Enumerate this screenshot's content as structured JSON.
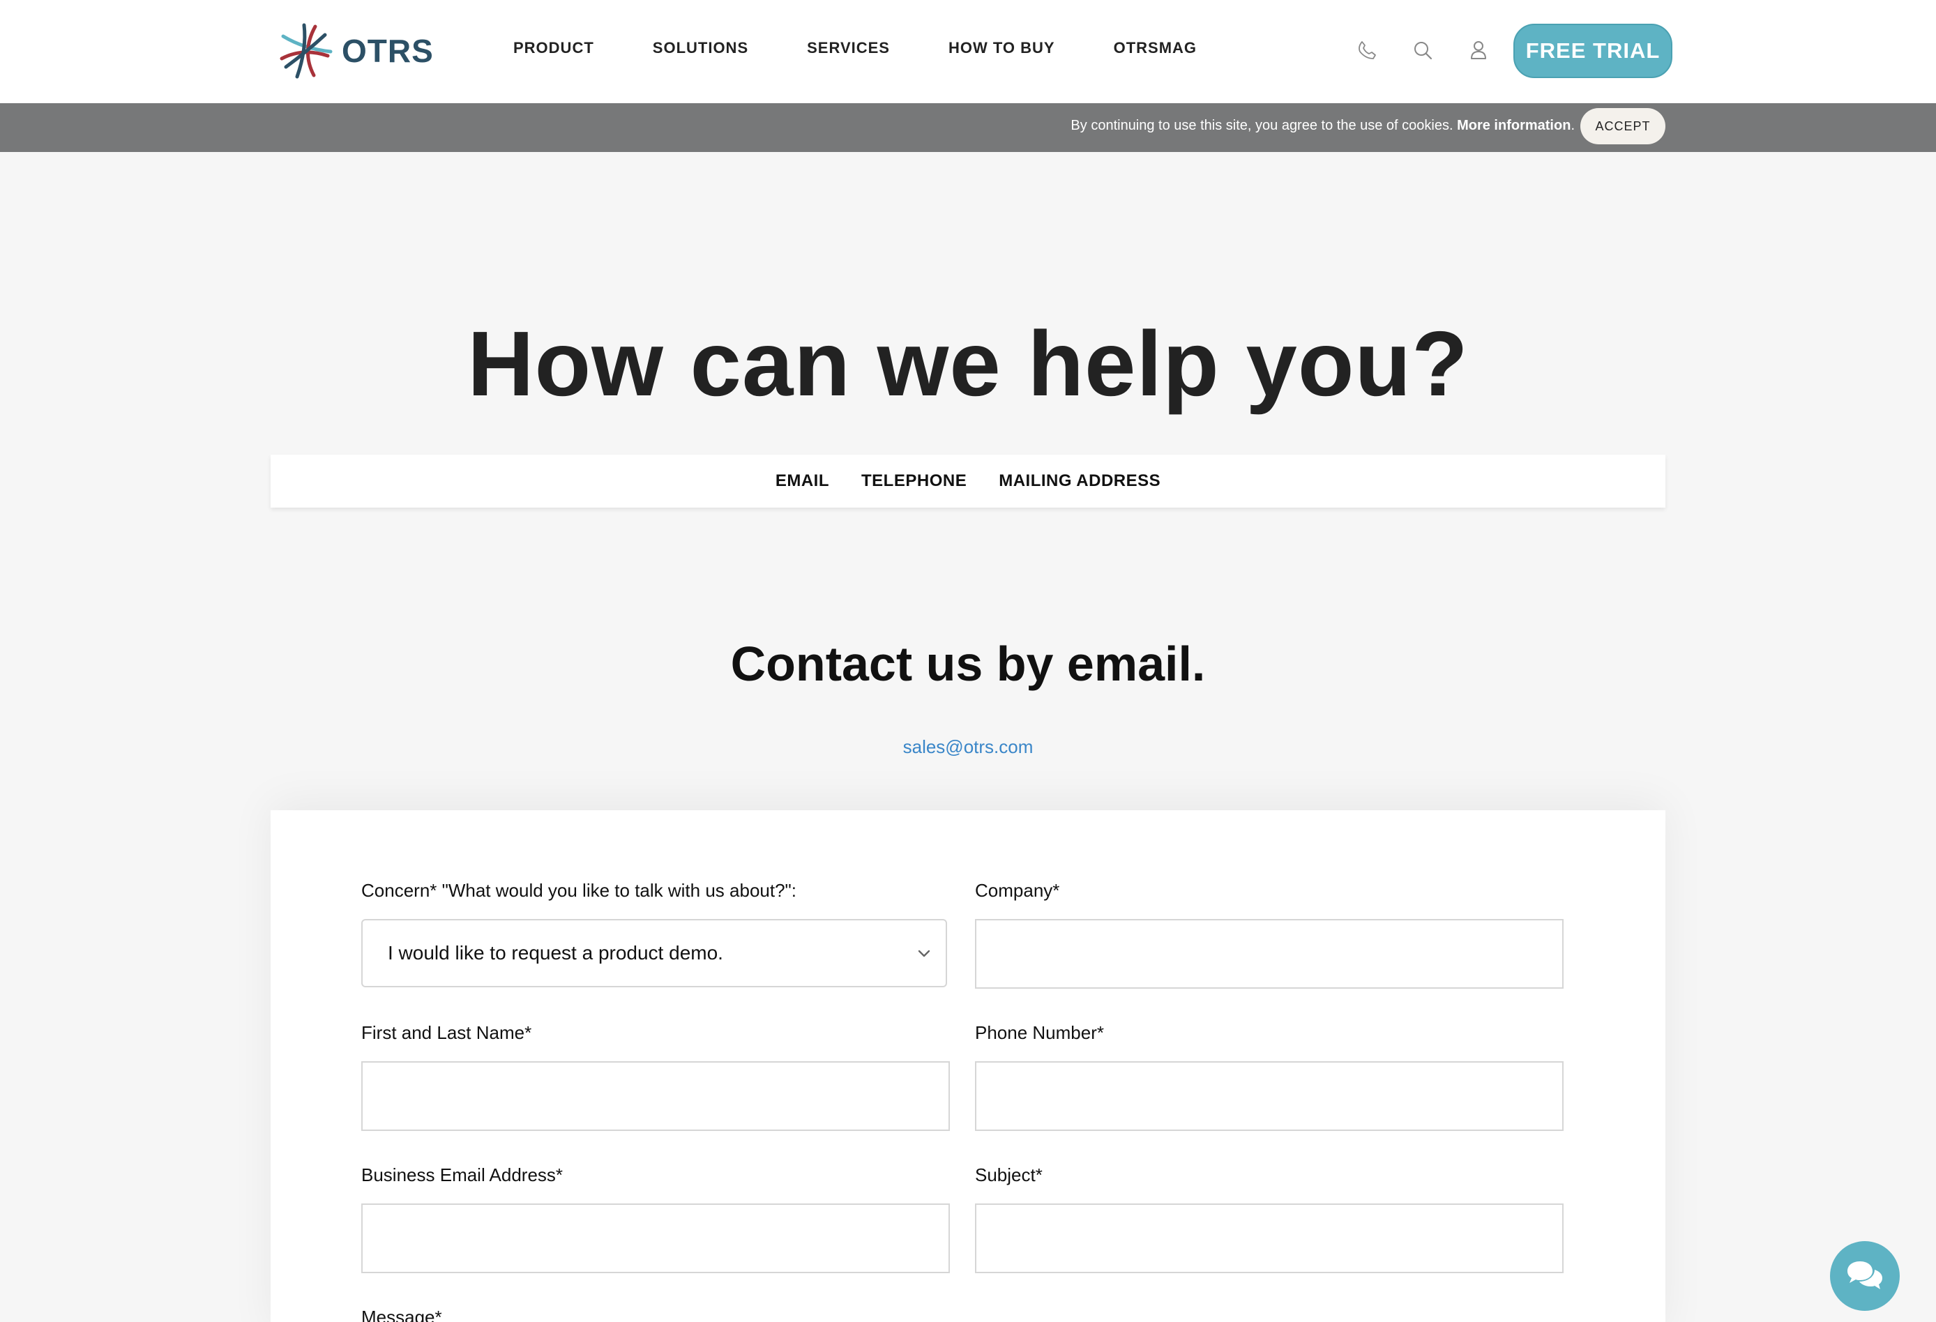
{
  "brand": {
    "name": "OTRS",
    "colors": {
      "primary": "#5eb3c4",
      "dark": "#2c5066",
      "logo_red": "#a8323a",
      "link": "#3a86c8"
    }
  },
  "nav": {
    "items": [
      {
        "label": "PRODUCT"
      },
      {
        "label": "SOLUTIONS"
      },
      {
        "label": "SERVICES"
      },
      {
        "label": "HOW TO BUY"
      },
      {
        "label": "OTRSMAG"
      }
    ],
    "icons": [
      "phone-icon",
      "search-icon",
      "user-icon"
    ],
    "cta_label": "FREE TRIAL"
  },
  "cookie_bar": {
    "text": "By continuing to use this site, you agree to the use of cookies.",
    "more_label": "More information",
    "after_more": ".",
    "accept_label": "ACCEPT"
  },
  "hero": {
    "title": "How can we help you?",
    "tabs": [
      {
        "label": "EMAIL"
      },
      {
        "label": "TELEPHONE"
      },
      {
        "label": "MAILING ADDRESS"
      }
    ]
  },
  "contact": {
    "title": "Contact us by email.",
    "email": "sales@otrs.com"
  },
  "form": {
    "concern_label": "Concern* \"What would you like to talk with us about?\":",
    "concern_value": "I would like to request a product demo.",
    "company_label": "Company*",
    "company_value": "",
    "name_label": "First and Last Name*",
    "name_value": "",
    "phone_label": "Phone Number*",
    "phone_value": "",
    "business_email_label": "Business Email Address*",
    "business_email_value": "",
    "subject_label": "Subject*",
    "subject_value": "",
    "message_label": "Message*"
  },
  "chat": {
    "icon": "chat-bubbles-icon"
  }
}
